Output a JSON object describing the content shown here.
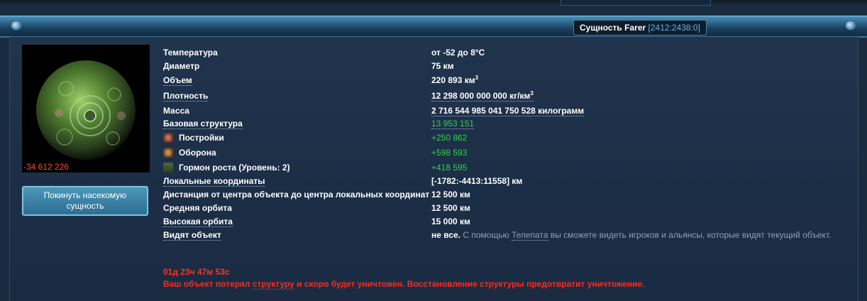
{
  "window": {
    "title": "Сущность Farer",
    "coords": "[2412:2438:0]"
  },
  "planet": {
    "hp_text": "-34 612 226"
  },
  "leave_button_label": "Покинуть насекомую сущность",
  "rows": [
    {
      "label": "Температура",
      "value": "от -52 до 8°C"
    },
    {
      "label": "Диаметр",
      "value": "75 км"
    },
    {
      "label": "Объем",
      "value": "220 893 км",
      "sup": "3"
    },
    {
      "label": "Плотность",
      "value": "12 298 000 000 000 кг/км",
      "sup": "3"
    },
    {
      "label": "Масса",
      "value": "2 716 544 985 041 750 528 килограмм"
    },
    {
      "label": "Базовая структура",
      "value": "13 953 151"
    },
    {
      "label": "Постройки",
      "value": "+250 862",
      "icon": "buildings-icon"
    },
    {
      "label": "Оборона",
      "value": "+598 593",
      "icon": "defense-icon"
    },
    {
      "label": "Гормон роста (Уровень: 2)",
      "value": "+418 595",
      "icon": "growth-hormone-icon"
    },
    {
      "label": "Локальные координаты",
      "value": "[-1782:-4413:11558] км"
    },
    {
      "label": "Дистанция от центра объекта до центра локальных координат",
      "value": "12 500 км"
    },
    {
      "label": "Средняя орбита",
      "value": "12 500 км"
    },
    {
      "label": "Высокая орбита",
      "value": "15 000 км"
    },
    {
      "label": "Видят объект",
      "value": "не все.",
      "note_before": "С помощью",
      "note_link": "Телепата",
      "note_after": "вы сможете видеть игроков и альянсы, которые видят текущий объект."
    }
  ],
  "timer": "01д 23ч 47м 53с",
  "warning": {
    "before": "Ваш объект потерял",
    "link": "структуру",
    "after": "и скоро будет уничтожен. Восстановление структуры предотвратит уничтожение."
  },
  "colors": {
    "positive": "#2fd24a",
    "negative": "#ff3322",
    "accent": "#5fb4e4"
  }
}
